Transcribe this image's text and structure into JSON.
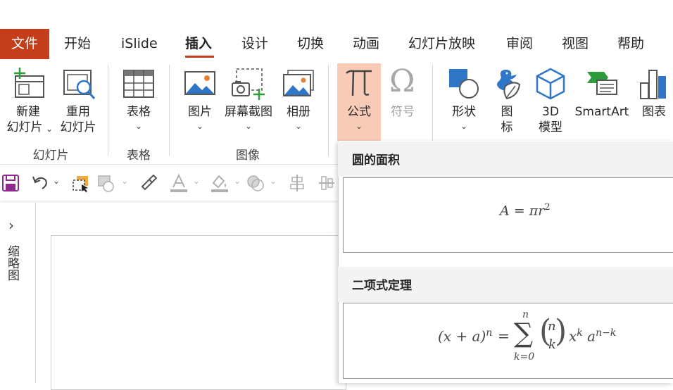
{
  "menu": {
    "file": "文件",
    "home": "开始",
    "islide": "iSlide",
    "insert": "插入",
    "design": "设计",
    "transitions": "切换",
    "animations": "动画",
    "slideshow": "幻灯片放映",
    "review": "审阅",
    "view": "视图",
    "help": "帮助"
  },
  "ribbon": {
    "new_slide_line1": "新建",
    "new_slide_line2": "幻灯片",
    "reuse_line1": "重用",
    "reuse_line2": "幻灯片",
    "table": "表格",
    "pictures": "图片",
    "screenshot": "屏幕截图",
    "album": "相册",
    "equation": "公式",
    "symbol": "符号",
    "shapes": "形状",
    "icons_line1": "图",
    "icons_line2": "标",
    "models_line1": "3D",
    "models_line2": "模型",
    "smartart": "SmartArt",
    "chart": "图表",
    "groups": {
      "slides": "幻灯片",
      "tables": "表格",
      "images": "图像"
    },
    "colors": {
      "accent": "#c43e1c",
      "equation_highlight": "#f8cbb7"
    }
  },
  "thumbnails": {
    "label": "缩略图",
    "expand": "›"
  },
  "equations": {
    "circle_title": "圆的面积",
    "circle": {
      "lhs": "A",
      "eq": "=",
      "pi": "π",
      "r": "r",
      "exp": "2"
    },
    "binomial_title": "二项式定理",
    "binomial": {
      "lhs": "(x + a)",
      "lhs_exp": "n",
      "eq": "=",
      "sum": "∑",
      "upper": "n",
      "lower": "k=0",
      "binom_top": "n",
      "binom_bottom": "k",
      "x": "x",
      "x_exp": "k",
      "a": "a",
      "a_exp": "n−k"
    }
  }
}
